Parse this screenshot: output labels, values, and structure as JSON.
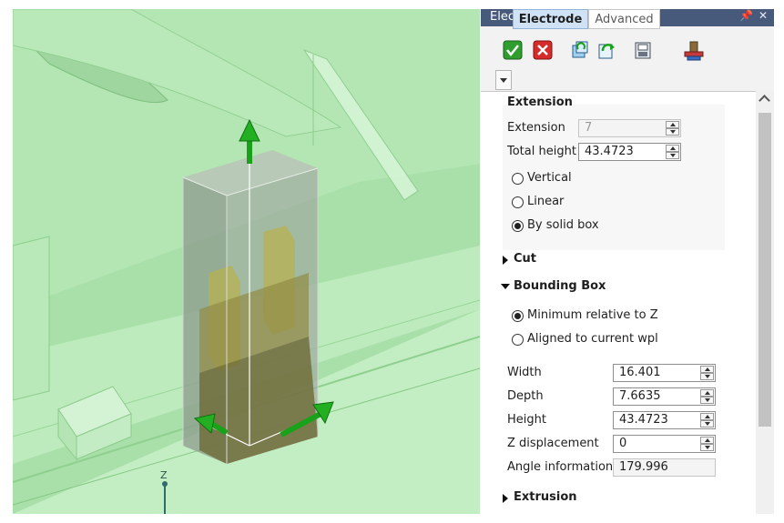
{
  "panel": {
    "title": "Electrode",
    "pin_glyph": "📌",
    "close_glyph": "✕",
    "toolbar": [
      "ok-icon",
      "cancel-icon",
      "copy-refresh-icon",
      "apply-icon",
      "save-icon",
      "electrode-tool-icon"
    ],
    "tabs": [
      {
        "label": "Electrode",
        "active": true
      },
      {
        "label": "Advanced",
        "active": false
      }
    ],
    "extension": {
      "title": "Extension",
      "extension_label": "Extension",
      "extension_value": "7",
      "total_height_label": "Total height",
      "total_height_value": "43.4723",
      "options": [
        "Vertical",
        "Linear",
        "By solid box"
      ],
      "selected": 2
    },
    "cut": {
      "title": "Cut"
    },
    "bounding_box": {
      "title": "Bounding Box",
      "options": [
        "Minimum relative to Z",
        "Aligned to current wpl"
      ],
      "selected": 0,
      "width_label": "Width",
      "width_value": "16.401",
      "depth_label": "Depth",
      "depth_value": "7.6635",
      "height_label": "Height",
      "height_value": "43.4723",
      "z_label": "Z displacement",
      "z_value": "0",
      "angle_label": "Angle information",
      "angle_value": "179.996"
    },
    "extrusion": {
      "title": "Extrusion"
    }
  },
  "viewport": {
    "axis_label": "Z"
  },
  "colors": {
    "titlebar": "#475a7c",
    "tab_active": "#cfe2f6",
    "model_green": "#c3eec3",
    "arrow_green": "#1aa11a"
  }
}
